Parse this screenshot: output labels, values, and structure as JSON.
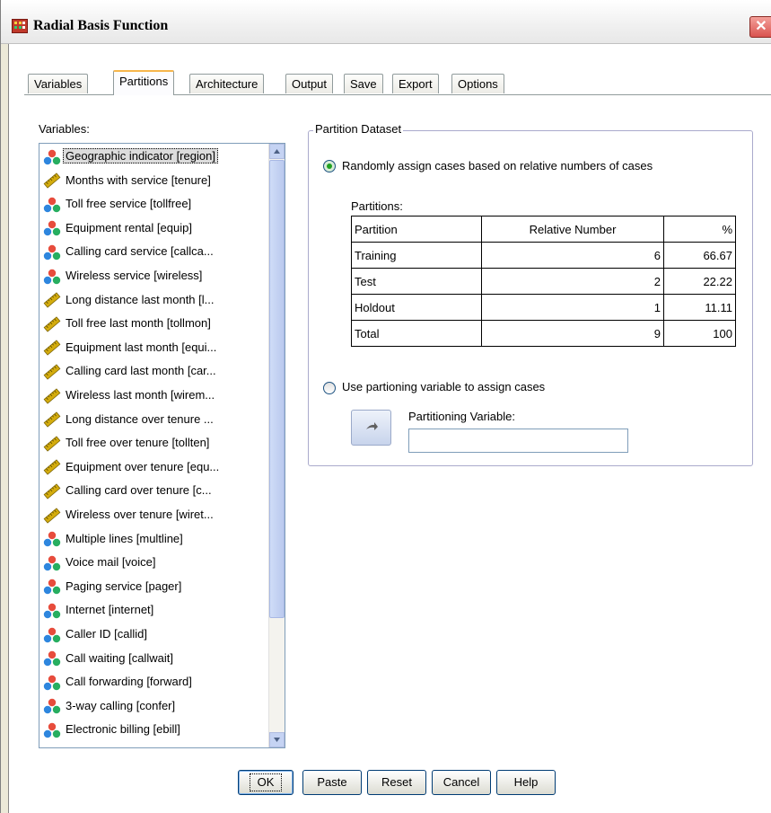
{
  "window": {
    "title": "Radial Basis Function",
    "close_label": "✕"
  },
  "tabs": [
    {
      "label": "Variables"
    },
    {
      "label": "Partitions",
      "active": true
    },
    {
      "label": "Architecture"
    },
    {
      "label": "Output"
    },
    {
      "label": "Save"
    },
    {
      "label": "Export"
    },
    {
      "label": "Options"
    }
  ],
  "variables": {
    "label": "Variables:",
    "items": [
      {
        "label": "Geographic indicator [region]",
        "icon": "nominal-icon",
        "selected": true
      },
      {
        "label": "Months with service [tenure]",
        "icon": "scale-icon"
      },
      {
        "label": "Toll free service [tollfree]",
        "icon": "nominal-icon"
      },
      {
        "label": "Equipment rental [equip]",
        "icon": "nominal-icon"
      },
      {
        "label": "Calling card service [callca...",
        "icon": "nominal-icon"
      },
      {
        "label": "Wireless service [wireless]",
        "icon": "nominal-icon"
      },
      {
        "label": "Long distance last month [l...",
        "icon": "scale-icon"
      },
      {
        "label": "Toll free last month [tollmon]",
        "icon": "scale-icon"
      },
      {
        "label": "Equipment last month [equi...",
        "icon": "scale-icon"
      },
      {
        "label": "Calling card last month [car...",
        "icon": "scale-icon"
      },
      {
        "label": "Wireless last month [wirem...",
        "icon": "scale-icon"
      },
      {
        "label": "Long distance over tenure ...",
        "icon": "scale-icon"
      },
      {
        "label": "Toll free over tenure [tollten]",
        "icon": "scale-icon"
      },
      {
        "label": "Equipment over tenure [equ...",
        "icon": "scale-icon"
      },
      {
        "label": "Calling card over tenure [c...",
        "icon": "scale-icon"
      },
      {
        "label": "Wireless over tenure [wiret...",
        "icon": "scale-icon"
      },
      {
        "label": "Multiple lines [multline]",
        "icon": "nominal-icon"
      },
      {
        "label": "Voice mail [voice]",
        "icon": "nominal-icon"
      },
      {
        "label": "Paging service [pager]",
        "icon": "nominal-icon"
      },
      {
        "label": "Internet [internet]",
        "icon": "nominal-icon"
      },
      {
        "label": "Caller ID [callid]",
        "icon": "nominal-icon"
      },
      {
        "label": "Call waiting [callwait]",
        "icon": "nominal-icon"
      },
      {
        "label": "Call forwarding [forward]",
        "icon": "nominal-icon"
      },
      {
        "label": "3-way calling [confer]",
        "icon": "nominal-icon"
      },
      {
        "label": "Electronic billing [ebill]",
        "icon": "nominal-icon"
      }
    ]
  },
  "partition": {
    "group_title": "Partition Dataset",
    "option_random": "Randomly assign cases based on relative numbers of cases",
    "option_random_checked": true,
    "partitions_label": "Partitions:",
    "table": {
      "headers": [
        "Partition",
        "Relative Number",
        "%"
      ],
      "rows": [
        [
          "Training",
          "6",
          "66.67"
        ],
        [
          "Test",
          "2",
          "22.22"
        ],
        [
          "Holdout",
          "1",
          "11.11"
        ],
        [
          "Total",
          "9",
          "100"
        ]
      ]
    },
    "option_variable": "Use partioning variable to assign cases",
    "partitioning_variable_label": "Partitioning Variable:",
    "partitioning_variable_value": ""
  },
  "buttons": {
    "ok": "OK",
    "paste": "Paste",
    "reset": "Reset",
    "cancel": "Cancel",
    "help": "Help"
  },
  "colors": {
    "nominal_icon": [
      "#e74c3c",
      "#2e86de",
      "#27ae60"
    ],
    "scale_icon": "#d4ac0d",
    "radio_checked": "#21a121"
  }
}
